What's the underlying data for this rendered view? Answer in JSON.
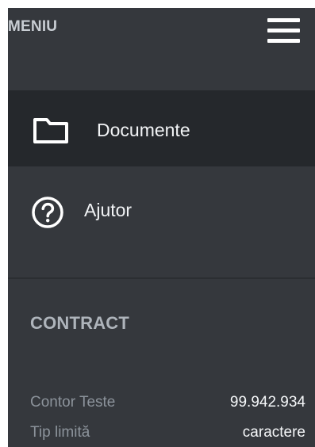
{
  "header": {
    "title": "MENIU",
    "menu_icon": "hamburger-menu-icon"
  },
  "nav": {
    "items": [
      {
        "label": "Documente",
        "icon": "folder-icon",
        "active": true
      },
      {
        "label": "Ajutor",
        "icon": "help-circle-icon",
        "active": false
      }
    ]
  },
  "contract": {
    "title": "CONTRACT",
    "rows": [
      {
        "label": "Contor Teste",
        "value": "99.942.934"
      },
      {
        "label": "Tip limită",
        "value": "caractere"
      }
    ]
  },
  "colors": {
    "panel_background": "#35383d",
    "active_item_background": "#25282c",
    "text_primary": "#f2f4f6",
    "text_muted": "#8c939b"
  }
}
